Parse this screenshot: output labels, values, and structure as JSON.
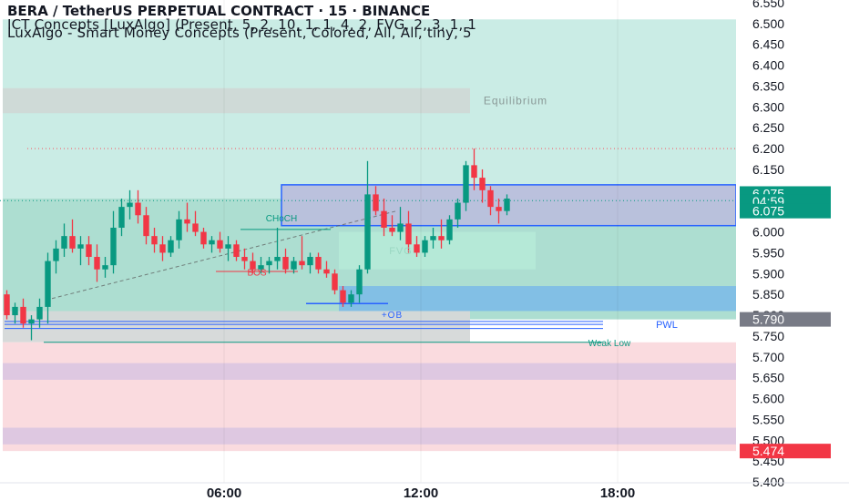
{
  "header": {
    "title": "BERA / TetherUS PERPETUAL CONTRACT · 15 · BINANCE",
    "indicator1": "ICT Concepts [LuxAlgo] (Present, 5, 2, 10, 1, 1, 4, 2, FVG, 2, 3, 1, 1",
    "indicator2": "LuxAlgo - Smart Money Concepts (Present, Colored, All, All, tiny, 5"
  },
  "chart_data": {
    "type": "candlestick",
    "symbol": "BERA / TetherUS PERPETUAL CONTRACT",
    "interval": "15",
    "exchange": "BINANCE",
    "y_axis": {
      "range": [
        5.4,
        6.55
      ],
      "ticks": [
        "6.550",
        "6.500",
        "6.450",
        "6.400",
        "6.350",
        "6.300",
        "6.250",
        "6.200",
        "6.150",
        "6.100",
        "6.050",
        "6.000",
        "5.950",
        "5.900",
        "5.850",
        "5.800",
        "5.750",
        "5.700",
        "5.650",
        "5.600",
        "5.550",
        "5.500",
        "5.450",
        "5.400"
      ]
    },
    "x_axis": {
      "ticks": [
        {
          "label": "06:00",
          "bar": 27
        },
        {
          "label": "12:00",
          "bar": 51
        },
        {
          "label": "18:00",
          "bar": 75
        }
      ],
      "total_bars": 90
    },
    "price_labels": [
      {
        "text": "6.075",
        "price": 6.092,
        "color": "#089981"
      },
      {
        "text": "04:59",
        "price": 6.073,
        "color": "#089981"
      },
      {
        "text": "6.075",
        "price": 6.05,
        "color": "#089981"
      },
      {
        "text": "5.790",
        "price": 5.79,
        "color": "#787b86"
      },
      {
        "text": "5.474",
        "price": 5.474,
        "color": "#f23645"
      }
    ],
    "candles": [
      [
        5.85,
        5.86,
        5.79,
        5.8
      ],
      [
        5.8,
        5.83,
        5.78,
        5.82
      ],
      [
        5.82,
        5.84,
        5.77,
        5.78
      ],
      [
        5.78,
        5.8,
        5.74,
        5.79
      ],
      [
        5.79,
        5.84,
        5.77,
        5.82
      ],
      [
        5.82,
        5.95,
        5.78,
        5.93
      ],
      [
        5.93,
        5.98,
        5.9,
        5.96
      ],
      [
        5.96,
        6.02,
        5.94,
        5.99
      ],
      [
        5.99,
        6.03,
        5.95,
        5.96
      ],
      [
        5.96,
        5.99,
        5.92,
        5.97
      ],
      [
        5.97,
        5.99,
        5.92,
        5.94
      ],
      [
        5.94,
        5.97,
        5.88,
        5.91
      ],
      [
        5.91,
        5.94,
        5.89,
        5.92
      ],
      [
        5.92,
        6.05,
        5.9,
        6.01
      ],
      [
        6.01,
        6.08,
        5.99,
        6.06
      ],
      [
        6.06,
        6.1,
        6.03,
        6.07
      ],
      [
        6.07,
        6.1,
        6.02,
        6.04
      ],
      [
        6.04,
        6.06,
        5.97,
        5.99
      ],
      [
        5.99,
        6.01,
        5.95,
        5.97
      ],
      [
        5.97,
        5.99,
        5.93,
        5.95
      ],
      [
        5.95,
        5.99,
        5.94,
        5.98
      ],
      [
        5.98,
        6.05,
        5.96,
        6.03
      ],
      [
        6.03,
        6.07,
        6.0,
        6.02
      ],
      [
        6.02,
        6.05,
        5.99,
        6.0
      ],
      [
        6.0,
        6.01,
        5.96,
        5.97
      ],
      [
        5.97,
        5.99,
        5.95,
        5.98
      ],
      [
        5.98,
        6.0,
        5.95,
        5.96
      ],
      [
        5.96,
        5.99,
        5.93,
        5.97
      ],
      [
        5.97,
        5.98,
        5.93,
        5.94
      ],
      [
        5.94,
        5.96,
        5.91,
        5.93
      ],
      [
        5.93,
        5.95,
        5.9,
        5.91
      ],
      [
        5.91,
        5.94,
        5.9,
        5.92
      ],
      [
        5.92,
        5.94,
        5.9,
        5.93
      ],
      [
        5.93,
        6.01,
        5.91,
        5.94
      ],
      [
        5.94,
        5.96,
        5.9,
        5.91
      ],
      [
        5.91,
        5.94,
        5.9,
        5.93
      ],
      [
        5.93,
        5.99,
        5.91,
        5.92
      ],
      [
        5.92,
        5.95,
        5.9,
        5.94
      ],
      [
        5.94,
        5.95,
        5.9,
        5.91
      ],
      [
        5.91,
        5.93,
        5.89,
        5.9
      ],
      [
        5.9,
        5.91,
        5.85,
        5.86
      ],
      [
        5.86,
        5.87,
        5.82,
        5.83
      ],
      [
        5.83,
        5.86,
        5.82,
        5.85
      ],
      [
        5.85,
        5.92,
        5.83,
        5.91
      ],
      [
        5.91,
        6.17,
        5.9,
        6.09
      ],
      [
        6.09,
        6.11,
        6.04,
        6.05
      ],
      [
        6.05,
        6.08,
        5.99,
        6.01
      ],
      [
        6.01,
        6.04,
        5.99,
        6.0
      ],
      [
        6.0,
        6.06,
        5.98,
        6.02
      ],
      [
        6.02,
        6.05,
        5.95,
        5.97
      ],
      [
        5.97,
        5.99,
        5.94,
        5.95
      ],
      [
        5.95,
        5.99,
        5.94,
        5.98
      ],
      [
        5.98,
        6.01,
        5.96,
        5.99
      ],
      [
        5.99,
        6.03,
        5.96,
        5.98
      ],
      [
        5.98,
        6.04,
        5.97,
        6.03
      ],
      [
        6.03,
        6.08,
        6.01,
        6.07
      ],
      [
        6.07,
        6.17,
        6.05,
        6.16
      ],
      [
        6.16,
        6.2,
        6.1,
        6.13
      ],
      [
        6.13,
        6.15,
        6.07,
        6.1
      ],
      [
        6.1,
        6.11,
        6.04,
        6.06
      ],
      [
        6.06,
        6.08,
        6.02,
        6.05
      ],
      [
        6.05,
        6.09,
        6.04,
        6.08
      ]
    ],
    "zones": [
      {
        "name": "premium-zone",
        "from_bar": 0,
        "to_bar": 90,
        "top": 6.51,
        "bottom": 6.08,
        "color": "#c7ebe4"
      },
      {
        "name": "equilibrium-zone",
        "label": "Equilibrium",
        "from_bar": 0,
        "to_bar": 57,
        "top": 6.345,
        "bottom": 6.285,
        "color": "#cfd9d6"
      },
      {
        "name": "discount-zone-upper",
        "from_bar": 0,
        "to_bar": 90,
        "top": 6.08,
        "bottom": 5.79,
        "color": "#a9dccf"
      },
      {
        "name": "bearish-ob",
        "from_bar": 34,
        "to_bar": 90,
        "top": 6.113,
        "bottom": 6.015,
        "color": "#b9bfdc",
        "border": "#2962ff"
      },
      {
        "name": "fvg-zone",
        "label": "FVG",
        "from_bar": 41,
        "to_bar": 65,
        "top": 6.0,
        "bottom": 5.91,
        "color": "#b5e9d7"
      },
      {
        "name": "bullish-ob",
        "label": "+OB",
        "from_bar": 41,
        "to_bar": 90,
        "top": 5.87,
        "bottom": 5.81,
        "color": "#80bde6"
      },
      {
        "name": "gray-zone",
        "from_bar": 0,
        "to_bar": 57,
        "top": 5.81,
        "bottom": 5.735,
        "color": "#d5d8d8"
      },
      {
        "name": "red-zone",
        "from_bar": 0,
        "to_bar": 90,
        "top": 5.735,
        "bottom": 5.474,
        "color": "#fad9dd"
      },
      {
        "name": "purple-band-1",
        "from_bar": 0,
        "to_bar": 90,
        "top": 5.685,
        "bottom": 5.645,
        "color": "#dcc7e0"
      },
      {
        "name": "purple-band-2",
        "from_bar": 0,
        "to_bar": 90,
        "top": 5.53,
        "bottom": 5.49,
        "color": "#dcc7e0"
      }
    ],
    "labels": [
      {
        "text": "CHoCH",
        "bar": 34,
        "price": 6.025
      },
      {
        "text": "BOS",
        "bar": 31,
        "price": 5.895
      },
      {
        "text": "PWL",
        "bar": 81,
        "price": 5.77
      },
      {
        "text": "Weak Low",
        "bar": 74,
        "price": 5.726
      }
    ]
  }
}
